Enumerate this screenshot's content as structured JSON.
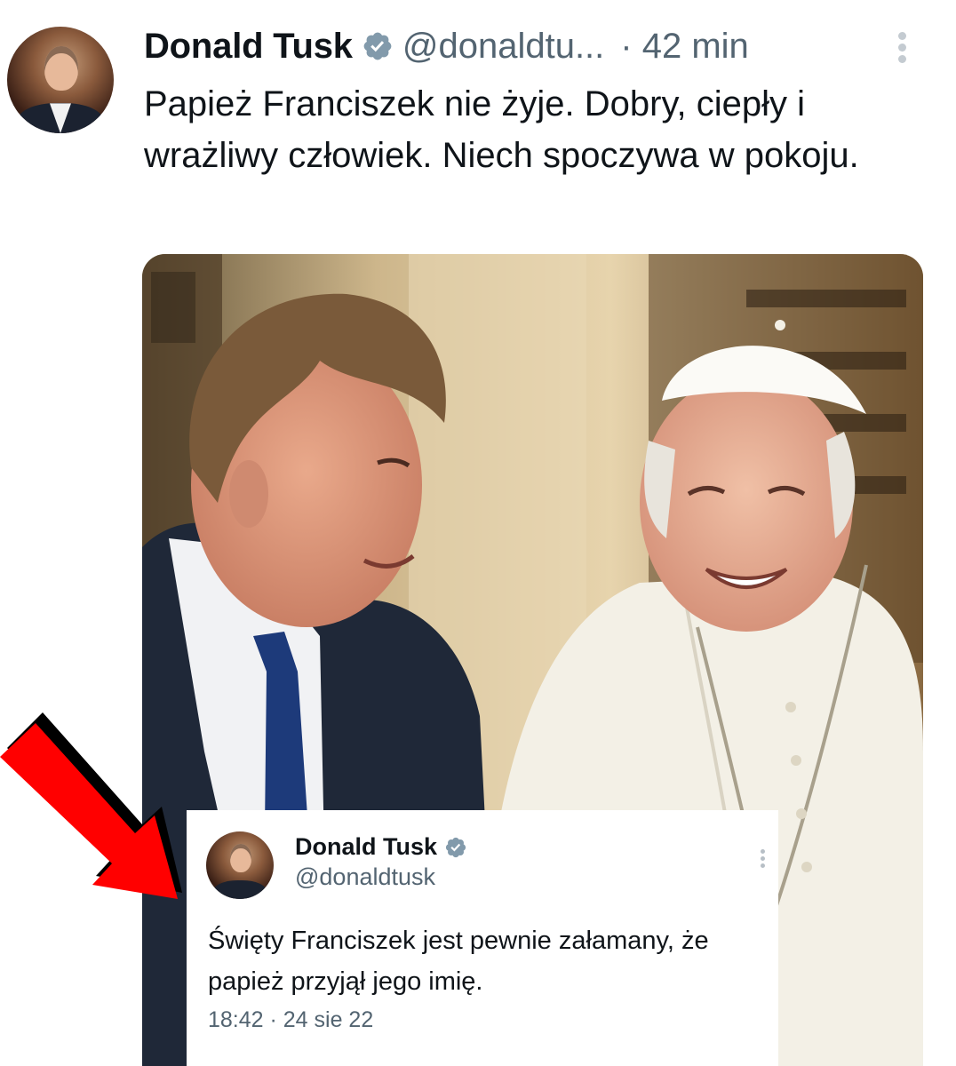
{
  "tweet": {
    "author_name": "Donald Tusk",
    "handle": "@donaldtu...",
    "timestamp": "· 42 min",
    "text": "Papież Franciszek nie żyje. Dobry, ciepły i wrażliwy człowiek. Niech spoczywa w pokoju."
  },
  "quoted_tweet": {
    "author_name": "Donald Tusk",
    "handle": "@donaldtusk",
    "text": "Święty Franciszek jest pewnie załamany, że papież przyjął jego imię.",
    "meta": "18:42 · 24 sie 22"
  },
  "icons": {
    "verified": "verified-badge-icon",
    "more": "more-options-icon",
    "annotation": "red-arrow-icon"
  },
  "colors": {
    "text_primary": "#0f1419",
    "text_secondary": "#536471",
    "verified_badge": "#829aab",
    "annotation_arrow": "#ff0000"
  }
}
